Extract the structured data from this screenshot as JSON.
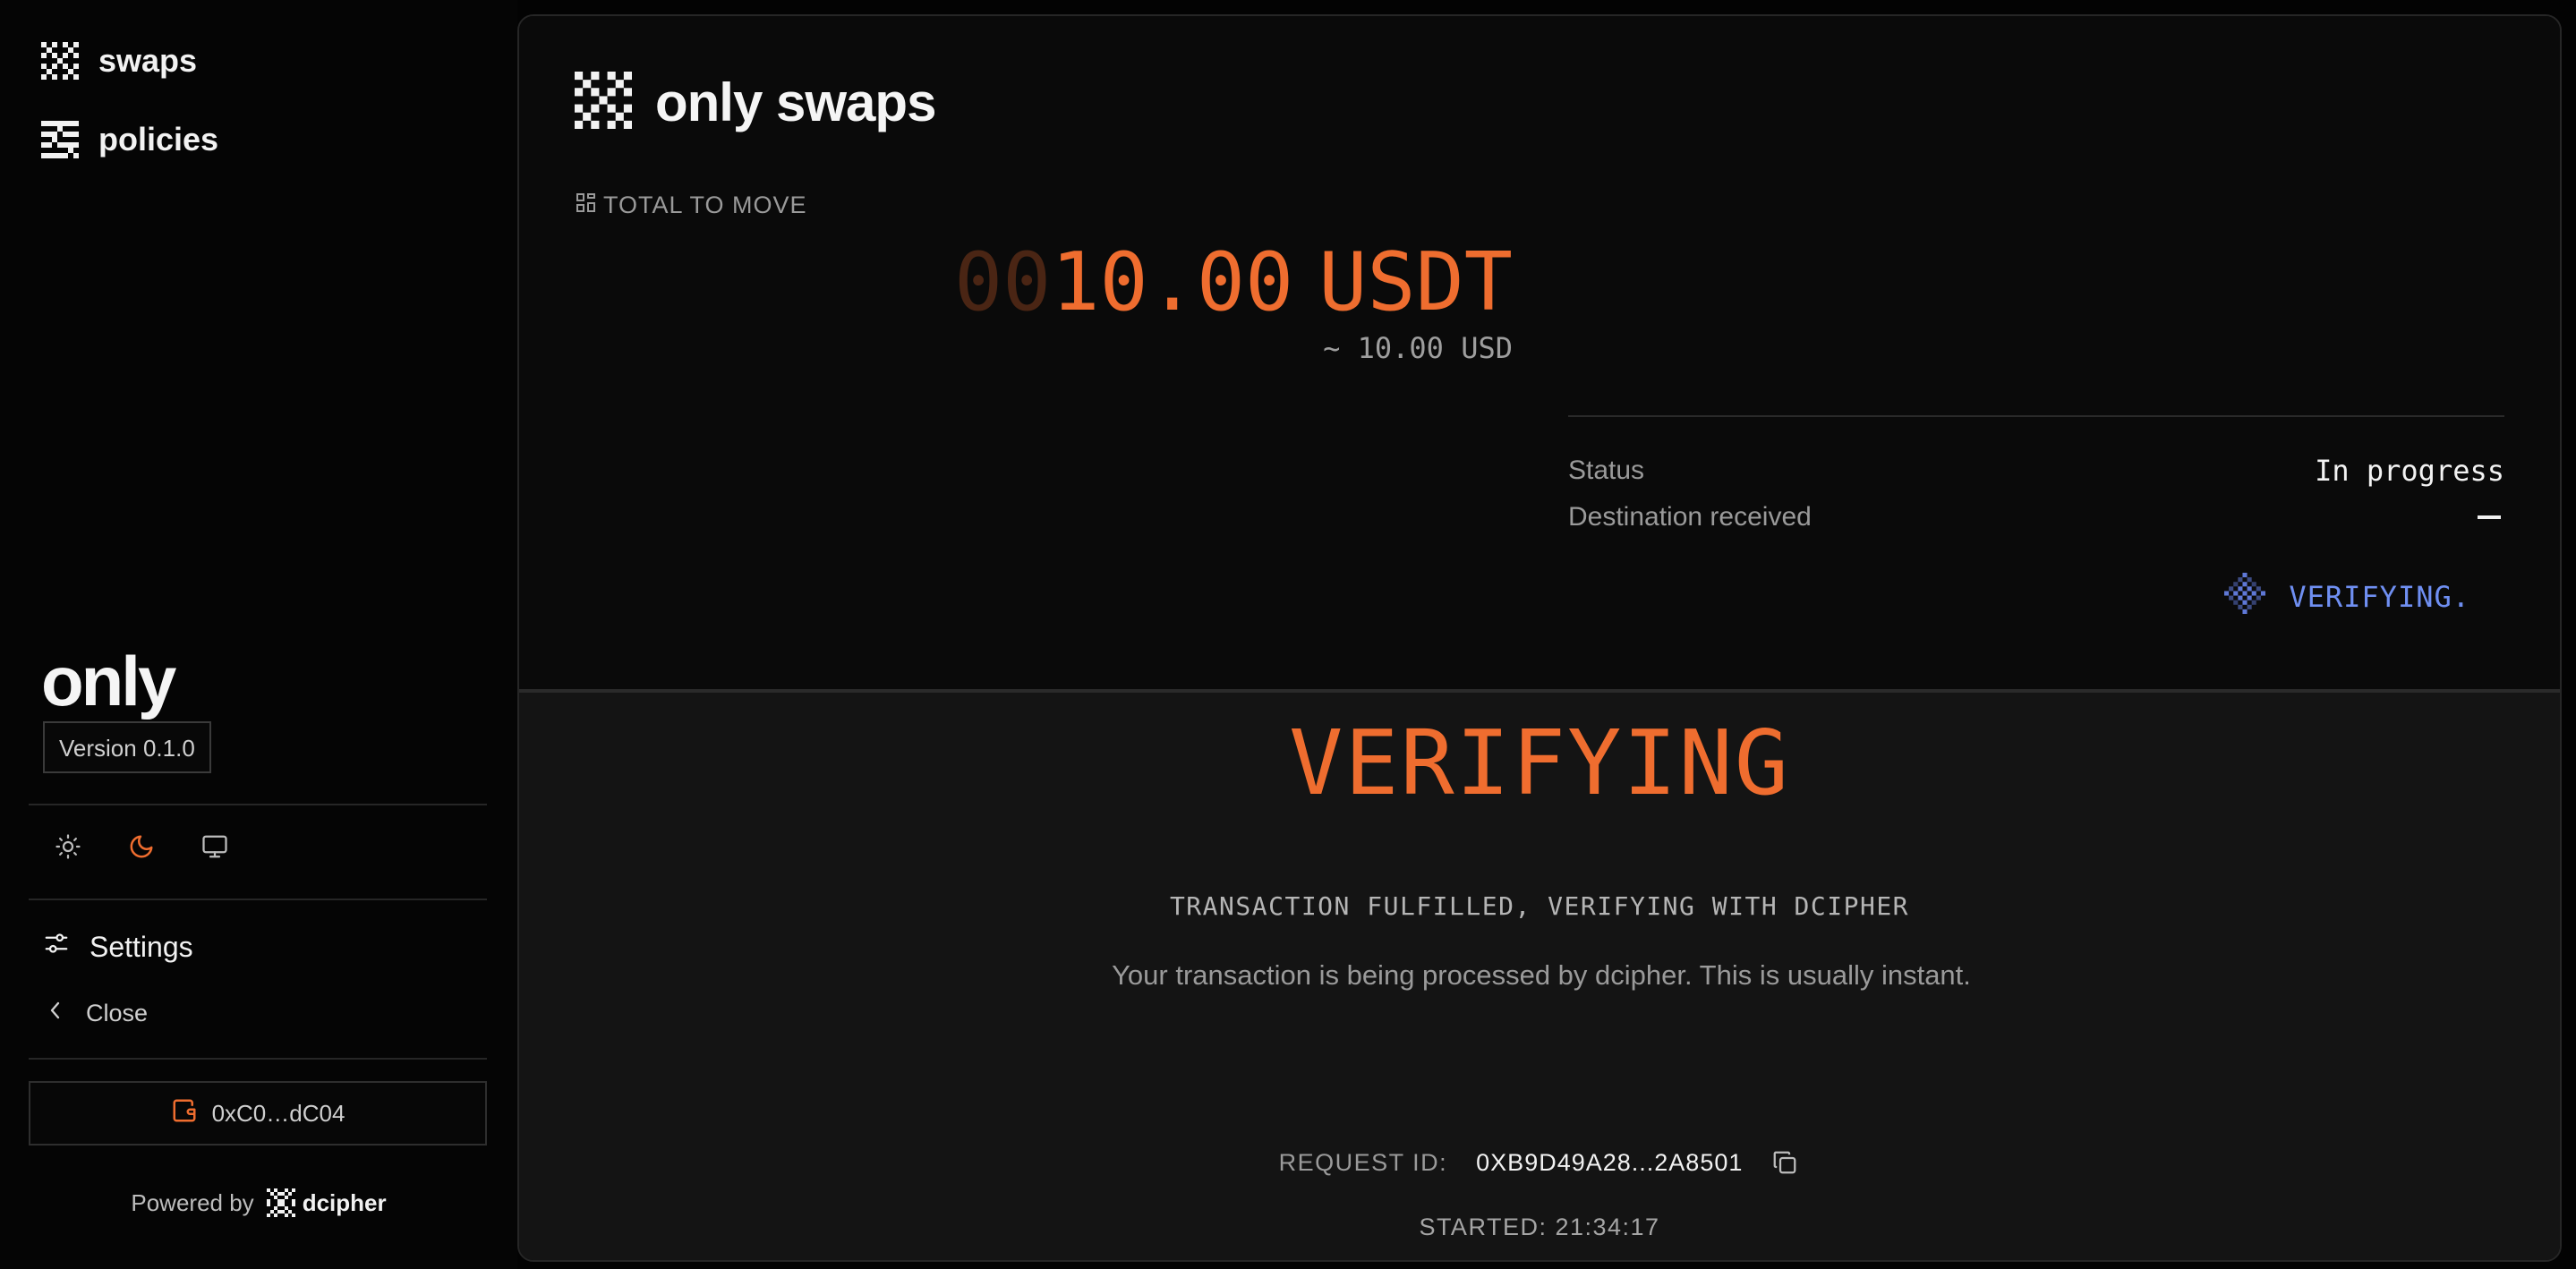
{
  "sidebar": {
    "nav": [
      {
        "label": "swaps",
        "icon": "swaps-checker-icon"
      },
      {
        "label": "policies",
        "icon": "policies-list-icon"
      }
    ],
    "brand": "only",
    "version": "Version 0.1.0",
    "theme_options": [
      "light-mode",
      "dark-mode",
      "system-mode"
    ],
    "active_theme": "dark-mode",
    "settings_label": "Settings",
    "close_label": "Close",
    "wallet_address": "0xC0…dC04",
    "powered_by_label": "Powered by",
    "powered_by_brand": "dcipher"
  },
  "main": {
    "app_title": "only swaps",
    "total_label": "TOTAL TO MOVE",
    "amount_padding": "00",
    "amount_value": "10.00",
    "token_symbol": "USDT",
    "usd_equivalent": "~ 10.00 USD",
    "status_label": "Status",
    "status_value": "In progress",
    "destination_label": "Destination received",
    "destination_value": "—",
    "verifying_badge": "VERIFYING.",
    "big_status": "VERIFYING",
    "sub_status": "TRANSACTION FULFILLED, VERIFYING WITH DCIPHER",
    "description": "Your transaction is being processed by dcipher. This is usually instant.",
    "request_id_label": "REQUEST ID:",
    "request_id_value": "0XB9D49A28...2A8501",
    "started": "STARTED: 21:34:17"
  },
  "colors": {
    "accent": "#ef6d2f",
    "accent_dim": "#4a2514",
    "verifying_blue": "#6f8ff2",
    "background": "#030303",
    "panel": "#0a0a0a",
    "panel_lower": "#141414"
  }
}
